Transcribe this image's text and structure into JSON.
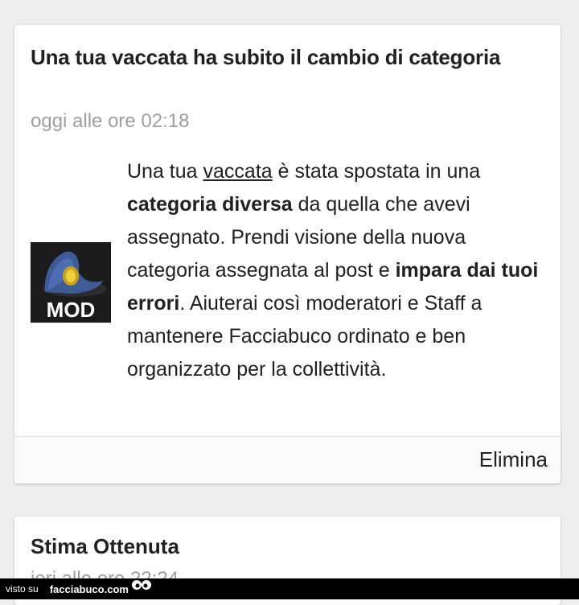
{
  "notification_1": {
    "title": "Una tua vaccata ha subito il cambio di categoria",
    "time": "oggi alle ore 02:18",
    "icon_label": "MOD",
    "body": {
      "p1": "Una tua ",
      "link": "vaccata",
      "p2": " è stata spostata in una ",
      "bold1": "categoria diversa",
      "p3": " da quella che avevi assegnato. Prendi visione della nuova categoria assegnata al post e ",
      "bold2": "impara dai tuoi errori",
      "p4": ". Aiuterai così moderatori e Staff a mantenere Facciabuco ordinato e ben organizzato per la collettività."
    },
    "delete_label": "Elimina"
  },
  "notification_2": {
    "title": "Stima Ottenuta",
    "time": "ieri alle ore 22:24"
  },
  "watermark": {
    "prefix": "visto su",
    "site": "facciabuco.com"
  }
}
